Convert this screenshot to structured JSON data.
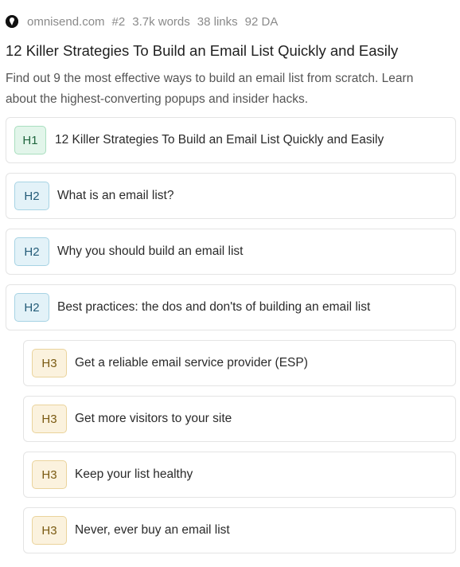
{
  "meta": {
    "domain": "omnisend.com",
    "rank": "#2",
    "words": "3.7k words",
    "links": "38 links",
    "da": "92 DA"
  },
  "title": "12 Killer Strategies To Build an Email List Quickly and Easily",
  "description": {
    "line1": "Find out 9 the most effective ways to build an email list from scratch. Learn",
    "line2": "about the highest-converting popups and insider hacks."
  },
  "outline": [
    {
      "tag": "H1",
      "text": "12 Killer Strategies To Build an Email List Quickly and Easily"
    },
    {
      "tag": "H2",
      "text": "What is an email list?"
    },
    {
      "tag": "H2",
      "text": "Why you should build an email list"
    },
    {
      "tag": "H2",
      "text": "Best practices: the dos and don'ts of building an email list"
    },
    {
      "tag": "H3",
      "text": "Get a reliable email service provider (ESP)"
    },
    {
      "tag": "H3",
      "text": "Get more visitors to your site"
    },
    {
      "tag": "H3",
      "text": "Keep your list healthy"
    },
    {
      "tag": "H3",
      "text": "Never, ever buy an email list"
    }
  ]
}
